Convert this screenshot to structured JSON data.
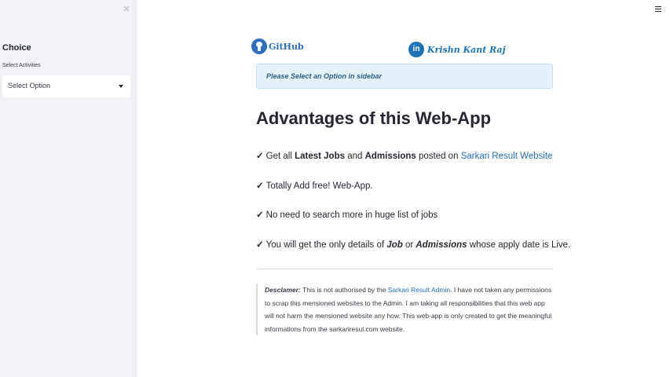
{
  "sidebar": {
    "close_glyph": "×",
    "heading": "Choice",
    "select_label": "Select Activities",
    "select_value": "Select Option"
  },
  "header": {
    "github_label": "GitHub",
    "linkedin_icon_text": "in",
    "linkedin_label": "Krishn Kant Raj"
  },
  "info": {
    "message": "Please Select an Option in sidebar"
  },
  "main": {
    "title": "Advantages of this Web-App",
    "check": "✓",
    "item1": {
      "t1": "Get all ",
      "b1": "Latest Jobs",
      "t2": " and ",
      "b2": "Admissions",
      "t3": " posted on ",
      "link": "Sarkari Result Website"
    },
    "item2": "Totally Add free! Web-App.",
    "item3": "No need to search more in huge list of jobs",
    "item4": {
      "t1": "You will get the only details of ",
      "b1": "Job",
      "t2": " or ",
      "b2": "Admissions",
      "t3": " whose apply date is Live."
    }
  },
  "disclaimer": {
    "lead": "Desclamer:",
    "t1": " This is not authorised by the ",
    "link": "Sarkari Result Admin",
    "t2": ". I have not taken any permissions to scrap this mensioned websites to the Admin. I am taking all responsibilities that this web app will not harm the mensioned website any how. This web-app is only created to get the meaningful informations from the sarkariresul.com website."
  },
  "colors": {
    "sidebar_bg": "#f0f2f6",
    "link": "#2a6db5",
    "info_bg": "#e5f1fb",
    "text": "#262730"
  },
  "icons": {
    "close": "close-icon",
    "menu": "hamburger-menu-icon",
    "caret": "chevron-down-icon",
    "github": "github-icon",
    "linkedin": "linkedin-icon"
  }
}
